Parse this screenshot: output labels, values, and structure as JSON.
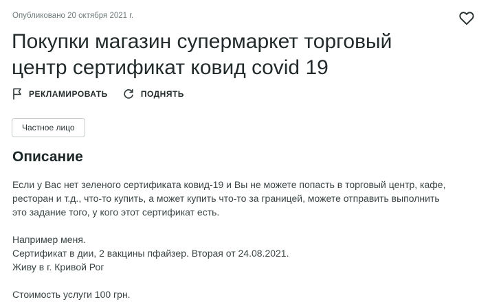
{
  "meta": {
    "published": "Опубликовано 20 октября 2021 г."
  },
  "ad": {
    "title": "Покупки магазин супермаркет торговый центр сертификат ковид covid 19"
  },
  "actions": {
    "promote_label": "РЕКЛАМИРОВАТЬ",
    "raise_label": "ПОДНЯТЬ"
  },
  "seller": {
    "type_badge": "Частное лицо"
  },
  "description": {
    "heading": "Описание",
    "lines": [
      "Если у Вас нет зеленого сертификата ковид-19 и Вы не можете попасть в торговый центр, кафе,",
      "ресторан и т.д., что-то купить, а может купить что-то за границей, можете отправить выполнить",
      "это задание того, у кого этот сертификат есть.",
      "",
      "Например меня.",
      "Сертификат в дии, 2 вакцины пфайзер. Вторая от 24.08.2021.",
      "Живу в г. Кривой Рог",
      "",
      "Стоимость услуги 100 грн."
    ]
  },
  "icons": {
    "favorite": "heart-outline-icon",
    "promote": "flag-outline-icon",
    "raise": "refresh-icon"
  },
  "colors": {
    "text": "#222a2b",
    "muted": "#6f7c7d",
    "border": "#c5cbcc"
  }
}
